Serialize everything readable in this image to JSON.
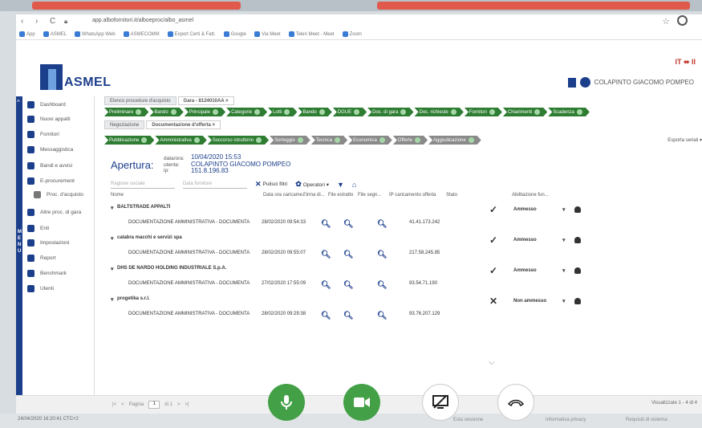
{
  "browser": {
    "url": "app.albofornitori.it/alboeproc/albo_asmel",
    "bookmarks": [
      "App",
      "ASMEL",
      "WhatsApp Web",
      "ASMECOMM",
      "Export Certi & Fatt.",
      "Google",
      "Via Meet",
      "Teleri Meet - Meet",
      "Zoom"
    ]
  },
  "header": {
    "logo_text": "ASMEL",
    "flags": "IT ⬌ II",
    "user_name": "COLAPINTO GIACOMO POMPEO"
  },
  "sidebar": {
    "menu_label": "MENU",
    "items": [
      {
        "label": "Dashboard",
        "icon": "home-icon"
      },
      {
        "label": "Nuovi appalti",
        "icon": "list-icon"
      },
      {
        "label": "Fornitori",
        "icon": "truck-icon"
      },
      {
        "label": "Messaggistica",
        "icon": "mail-icon"
      },
      {
        "label": "Bandi e avvisi",
        "icon": "megaphone-icon"
      },
      {
        "label": "E-procurement",
        "icon": "cart-icon"
      },
      {
        "label": "Proc. d'acquisto",
        "icon": "doc-icon"
      },
      {
        "label": "Altre proc. di gara",
        "icon": "folder-icon"
      },
      {
        "label": "Enti",
        "icon": "group-icon"
      },
      {
        "label": "Impostazioni",
        "icon": "gear-icon"
      },
      {
        "label": "Report",
        "icon": "report-icon"
      },
      {
        "label": "Benchmark",
        "icon": "chart-icon"
      },
      {
        "label": "Utenti",
        "icon": "user-icon"
      }
    ]
  },
  "tabs": {
    "top": [
      "Elenco procedure d'acquisto",
      "Gara - 8124010AA ×"
    ],
    "second": [
      "Negoziazione",
      "Documentazione d'offerta ×"
    ]
  },
  "steps_row1": [
    "Preliminare",
    "Bando",
    "Principale",
    "Categorie",
    "Lotti",
    "Bando",
    "DGUE",
    "Doc. di gara",
    "Doc. richieste",
    "Fornitori",
    "Chiarimenti",
    "Scadenza"
  ],
  "steps_row2": [
    "Pubblicazione",
    "Amministrativa",
    "Soccorso istruttorio",
    "Sorteggio",
    "Tecnica",
    "Economica",
    "Offerte",
    "Aggiudicazione"
  ],
  "export_label": "Esporta seriali ▾",
  "apertura": {
    "title": "Apertura:",
    "labels": [
      "data/ora:",
      "utente:",
      "ip:"
    ],
    "values": [
      "10/04/2020 15:53",
      "COLAPINTO GIACOMO POMPEO",
      "151.8.196.83"
    ]
  },
  "filters": {
    "ragione_placeholder": "Ragione sociale",
    "data_placeholder": "Data fornitore",
    "clear_label": "Pulisci filtri",
    "operators_label": "Operatori ▾"
  },
  "grid": {
    "columns": [
      "Nome",
      "Data ora caricame...",
      "Firma di...",
      "File estratto",
      "File segn...",
      "IP caricamento offerta",
      "Stato",
      "Abilitazione fun..."
    ],
    "rows": [
      {
        "company": "BALTSTRADE APPALTI",
        "doc": "DOCUMENTAZIONE AMMINISTRATIVA - DOCUMENTA",
        "date": "28/02/2020 09:54:33",
        "ip": "41.41.173.242",
        "mark": "✓",
        "status": "Ammesso"
      },
      {
        "company": "calabra macchi e servizi spa",
        "doc": "DOCUMENTAZIONE AMMINISTRATIVA - DOCUMENTA",
        "date": "28/02/2020 09:55:07",
        "ip": "217.58.245.85",
        "mark": "✓",
        "status": "Ammesso"
      },
      {
        "company": "DHS DE NARDO HOLDING INDUSTRIALE S.p.A.",
        "doc": "DOCUMENTAZIONE AMMINISTRATIVA - DOCUMENTA",
        "date": "27/02/2020 17:55:09",
        "ip": "93.54.71.190",
        "mark": "✓",
        "status": "Ammesso"
      },
      {
        "company": "progetika s.r.l.",
        "doc": "DOCUMENTAZIONE AMMINISTRATIVA - DOCUMENTA",
        "date": "28/02/2020 09:29:38",
        "ip": "93.76.207.129",
        "mark": "✕",
        "status": "Non ammesso"
      }
    ]
  },
  "footer": {
    "page_label": "Pagina",
    "page_value": "1",
    "of_label": "di 1",
    "visible_label": "Visualizzate 1 - 4 di 4"
  },
  "status": {
    "timestamp": "24/04/2020 16:20:41 CTC+2",
    "link1": "Esta sessione",
    "link2": "Informativa privacy",
    "link3": "Requisiti di sistema"
  }
}
